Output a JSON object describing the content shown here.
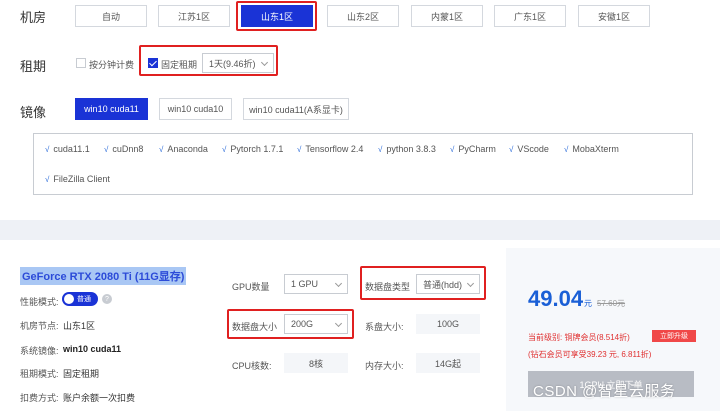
{
  "room": {
    "label": "机房",
    "options": [
      "自动",
      "江苏1区",
      "山东1区",
      "山东2区",
      "内蒙1区",
      "广东1区",
      "安徽1区"
    ],
    "selected_index": 2
  },
  "rent": {
    "label": "租期",
    "by_minute_label": "按分钟计费",
    "by_minute_checked": false,
    "fixed_label": "固定租期",
    "fixed_checked": true,
    "duration_value": "1天(9.46折)"
  },
  "image": {
    "label": "镜像",
    "options": [
      "win10 cuda11",
      "win10 cuda10",
      "win10 cuda11(A系显卡)"
    ],
    "selected_index": 0
  },
  "software": [
    "cuda11.1",
    "cuDnn8",
    "Anaconda",
    "Pytorch 1.7.1",
    "Tensorflow 2.4",
    "python 3.8.3",
    "PyCharm",
    "VScode",
    "MobaXterm",
    "FileZilla Client"
  ],
  "gpu_card": {
    "title": "GeForce RTX 2080 Ti (11G显存)",
    "perf_mode_label": "性能模式:",
    "perf_mode_value": "普通",
    "node_label": "机房节点:",
    "node_value": "山东1区",
    "image_label": "系统镜像:",
    "image_value": "win10 cuda11",
    "rent_mode_label": "租期模式:",
    "rent_mode_value": "固定租期",
    "deduct_label": "扣费方式:",
    "deduct_value": "账户余额一次扣费"
  },
  "config": {
    "gpu_count_label": "GPU数量",
    "gpu_count_value": "1 GPU",
    "disk_type_label": "数据盘类型",
    "disk_type_value": "普通(hdd)",
    "disk_size_label": "数据盘大小",
    "disk_size_value": "200G",
    "system_disk_label": "系盘大小:",
    "system_disk_value": "100G",
    "cpu_label": "CPU核数:",
    "cpu_value": "8核",
    "mem_label": "内存大小:",
    "mem_value": "14G起"
  },
  "pricing": {
    "price": "49.04",
    "unit": "元",
    "old_price": "57.60元",
    "vip_level_text": "当前级别: 铜牌会员(8.514折)",
    "upgrade_label": "立即升级",
    "diamond_text": "(钻石会员可享受39.23 元, 6.811折)",
    "buy_label": "1GPU 立即下单"
  },
  "watermark": "CSDN @智星云服务"
}
